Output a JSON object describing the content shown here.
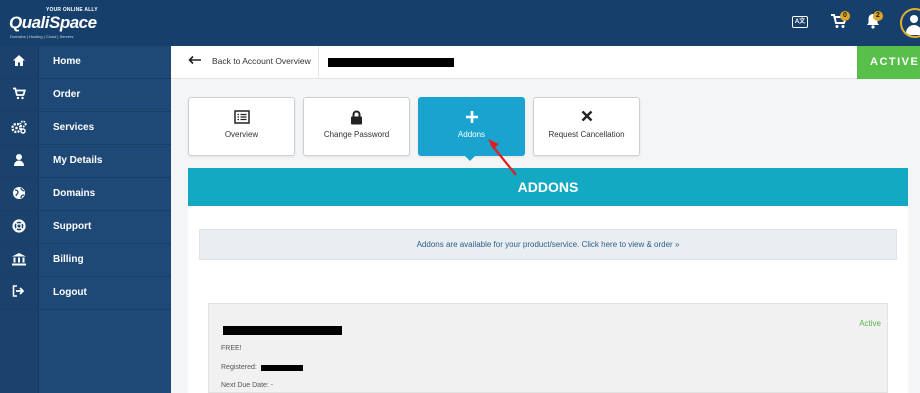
{
  "brand": {
    "tagline": "YOUR ONLINE ALLY",
    "name": "QualiSpace",
    "sub": "Domains | Hosting | Cloud | Servers"
  },
  "topbar": {
    "translate_label": "A文",
    "cart_count": "0",
    "notify_count": "2"
  },
  "sidebar": {
    "items": [
      {
        "label": "Home",
        "icon": "home-icon",
        "glyph": "⌂"
      },
      {
        "label": "Order",
        "icon": "cart-icon",
        "glyph": "🛒"
      },
      {
        "label": "Services",
        "icon": "cogs-icon",
        "glyph": "⚙"
      },
      {
        "label": "My Details",
        "icon": "user-icon",
        "glyph": "👤"
      },
      {
        "label": "Domains",
        "icon": "globe-icon",
        "glyph": "◍"
      },
      {
        "label": "Support",
        "icon": "lifebuoy-icon",
        "glyph": "◎"
      },
      {
        "label": "Billing",
        "icon": "bank-icon",
        "glyph": "🏛"
      },
      {
        "label": "Logout",
        "icon": "logout-icon",
        "glyph": "⇥"
      }
    ]
  },
  "header": {
    "back_label": "Back to Account Overview",
    "status": "ACTIVE"
  },
  "tiles": [
    {
      "label": "Overview",
      "icon": "list-icon",
      "glyph": "☰"
    },
    {
      "label": "Change Password",
      "icon": "lock-icon",
      "glyph": "🔒"
    },
    {
      "label": "Addons",
      "icon": "plus-icon",
      "glyph": "+"
    },
    {
      "label": "Request Cancellation",
      "icon": "close-icon",
      "glyph": "✕"
    }
  ],
  "addons": {
    "title": "ADDONS",
    "info": "Addons are available for your product/service. Click here to view & order »",
    "card": {
      "status": "Active",
      "price": "FREE!",
      "registered_label": "Registered:",
      "next_due": "Next Due Date: -"
    }
  },
  "colors": {
    "topbar": "#163f6b",
    "sidebar": "#1e4976",
    "accent": "#1aa3cf",
    "active": "#58c04a",
    "annotation": "#e02020"
  }
}
